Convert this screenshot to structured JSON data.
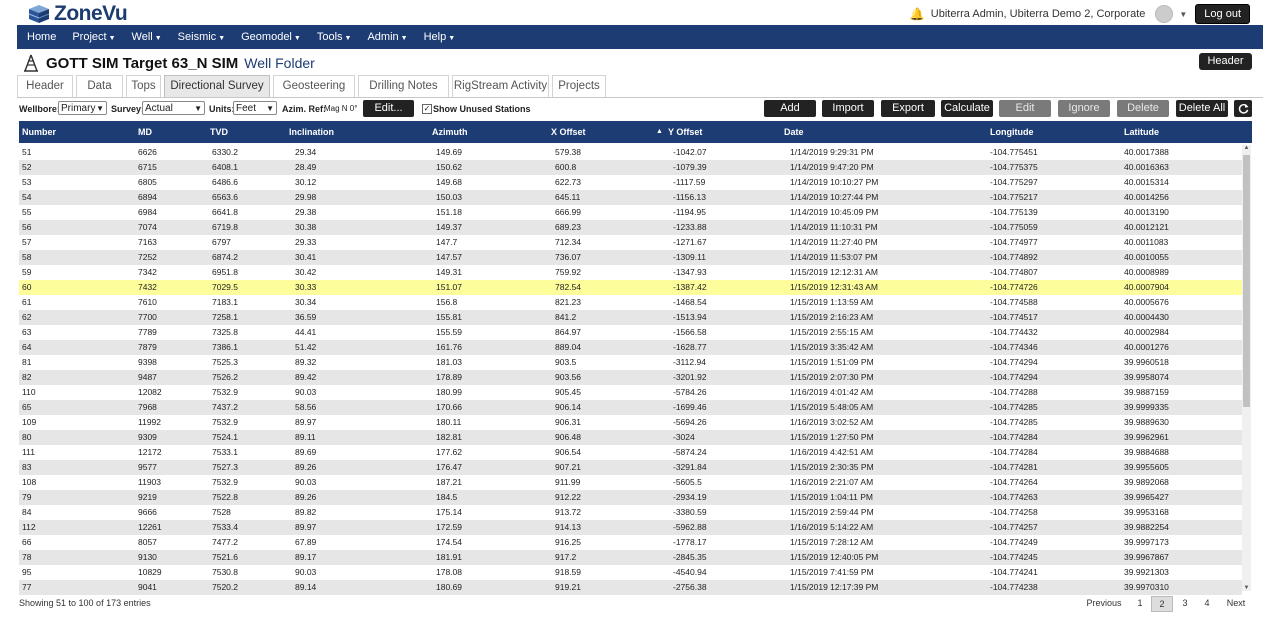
{
  "app": {
    "name": "ZoneVu"
  },
  "user": {
    "name": "Ubiterra Admin, Ubiterra Demo 2, Corporate",
    "logout_label": "Log out"
  },
  "nav": [
    {
      "label": "Home",
      "dropdown": false
    },
    {
      "label": "Project",
      "dropdown": true
    },
    {
      "label": "Well",
      "dropdown": true
    },
    {
      "label": "Seismic",
      "dropdown": true
    },
    {
      "label": "Geomodel",
      "dropdown": true
    },
    {
      "label": "Tools",
      "dropdown": true
    },
    {
      "label": "Admin",
      "dropdown": true
    },
    {
      "label": "Help",
      "dropdown": true
    }
  ],
  "well": {
    "title": "GOTT SIM Target 63_N SIM",
    "folder_label": "Well Folder",
    "header_button": "Header"
  },
  "tabs": [
    "Header",
    "Data",
    "Tops",
    "Directional Survey",
    "Geosteering",
    "Drilling Notes",
    "RigStream Activity",
    "Projects"
  ],
  "active_tab": "Directional Survey",
  "toolbar": {
    "wellbore_label": "Wellbore:",
    "wellbore_value": "Primary",
    "survey_label": "Survey:",
    "survey_value": "Actual",
    "units_label": "Units:",
    "units_value": "Feet",
    "azim_label": "Azim. Ref:",
    "azim_value": "Mag N 0°",
    "edit_ref_label": "Edit...",
    "show_unused_label": "Show Unused Stations",
    "show_unused_checked": true,
    "add": "Add",
    "import": "Import",
    "export": "Export",
    "calculate": "Calculate",
    "edit": "Edit",
    "ignore": "Ignore",
    "delete": "Delete",
    "delete_all": "Delete All"
  },
  "table": {
    "columns": [
      "Number",
      "MD",
      "TVD",
      "Inclination",
      "Azimuth",
      "X Offset",
      "Y Offset",
      "Date",
      "Longitude",
      "Latitude"
    ],
    "sorted_column": "X Offset",
    "sort_direction": "ascending",
    "highlighted_row": "60",
    "rows": [
      [
        "51",
        "6626",
        "6330.2",
        "29.34",
        "149.69",
        "579.38",
        "-1042.07",
        "1/14/2019 9:29:31 PM",
        "-104.775451",
        "40.0017388"
      ],
      [
        "52",
        "6715",
        "6408.1",
        "28.49",
        "150.62",
        "600.8",
        "-1079.39",
        "1/14/2019 9:47:20 PM",
        "-104.775375",
        "40.0016363"
      ],
      [
        "53",
        "6805",
        "6486.6",
        "30.12",
        "149.68",
        "622.73",
        "-1117.59",
        "1/14/2019 10:10:27 PM",
        "-104.775297",
        "40.0015314"
      ],
      [
        "54",
        "6894",
        "6563.6",
        "29.98",
        "150.03",
        "645.11",
        "-1156.13",
        "1/14/2019 10:27:44 PM",
        "-104.775217",
        "40.0014256"
      ],
      [
        "55",
        "6984",
        "6641.8",
        "29.38",
        "151.18",
        "666.99",
        "-1194.95",
        "1/14/2019 10:45:09 PM",
        "-104.775139",
        "40.0013190"
      ],
      [
        "56",
        "7074",
        "6719.8",
        "30.38",
        "149.37",
        "689.23",
        "-1233.88",
        "1/14/2019 11:10:31 PM",
        "-104.775059",
        "40.0012121"
      ],
      [
        "57",
        "7163",
        "6797",
        "29.33",
        "147.7",
        "712.34",
        "-1271.67",
        "1/14/2019 11:27:40 PM",
        "-104.774977",
        "40.0011083"
      ],
      [
        "58",
        "7252",
        "6874.2",
        "30.41",
        "147.57",
        "736.07",
        "-1309.11",
        "1/14/2019 11:53:07 PM",
        "-104.774892",
        "40.0010055"
      ],
      [
        "59",
        "7342",
        "6951.8",
        "30.42",
        "149.31",
        "759.92",
        "-1347.93",
        "1/15/2019 12:12:31 AM",
        "-104.774807",
        "40.0008989"
      ],
      [
        "60",
        "7432",
        "7029.5",
        "30.33",
        "151.07",
        "782.54",
        "-1387.42",
        "1/15/2019 12:31:43 AM",
        "-104.774726",
        "40.0007904"
      ],
      [
        "61",
        "7610",
        "7183.1",
        "30.34",
        "156.8",
        "821.23",
        "-1468.54",
        "1/15/2019 1:13:59 AM",
        "-104.774588",
        "40.0005676"
      ],
      [
        "62",
        "7700",
        "7258.1",
        "36.59",
        "155.81",
        "841.2",
        "-1513.94",
        "1/15/2019 2:16:23 AM",
        "-104.774517",
        "40.0004430"
      ],
      [
        "63",
        "7789",
        "7325.8",
        "44.41",
        "155.59",
        "864.97",
        "-1566.58",
        "1/15/2019 2:55:15 AM",
        "-104.774432",
        "40.0002984"
      ],
      [
        "64",
        "7879",
        "7386.1",
        "51.42",
        "161.76",
        "889.04",
        "-1628.77",
        "1/15/2019 3:35:42 AM",
        "-104.774346",
        "40.0001276"
      ],
      [
        "81",
        "9398",
        "7525.3",
        "89.32",
        "181.03",
        "903.5",
        "-3112.94",
        "1/15/2019 1:51:09 PM",
        "-104.774294",
        "39.9960518"
      ],
      [
        "82",
        "9487",
        "7526.2",
        "89.42",
        "178.89",
        "903.56",
        "-3201.92",
        "1/15/2019 2:07:30 PM",
        "-104.774294",
        "39.9958074"
      ],
      [
        "110",
        "12082",
        "7532.9",
        "90.03",
        "180.99",
        "905.45",
        "-5784.26",
        "1/16/2019 4:01:42 AM",
        "-104.774288",
        "39.9887159"
      ],
      [
        "65",
        "7968",
        "7437.2",
        "58.56",
        "170.66",
        "906.14",
        "-1699.46",
        "1/15/2019 5:48:05 AM",
        "-104.774285",
        "39.9999335"
      ],
      [
        "109",
        "11992",
        "7532.9",
        "89.97",
        "180.11",
        "906.31",
        "-5694.26",
        "1/16/2019 3:02:52 AM",
        "-104.774285",
        "39.9889630"
      ],
      [
        "80",
        "9309",
        "7524.1",
        "89.11",
        "182.81",
        "906.48",
        "-3024",
        "1/15/2019 1:27:50 PM",
        "-104.774284",
        "39.9962961"
      ],
      [
        "111",
        "12172",
        "7533.1",
        "89.69",
        "177.62",
        "906.54",
        "-5874.24",
        "1/16/2019 4:42:51 AM",
        "-104.774284",
        "39.9884688"
      ],
      [
        "83",
        "9577",
        "7527.3",
        "89.26",
        "176.47",
        "907.21",
        "-3291.84",
        "1/15/2019 2:30:35 PM",
        "-104.774281",
        "39.9955605"
      ],
      [
        "108",
        "11903",
        "7532.9",
        "90.03",
        "187.21",
        "911.99",
        "-5605.5",
        "1/16/2019 2:21:07 AM",
        "-104.774264",
        "39.9892068"
      ],
      [
        "79",
        "9219",
        "7522.8",
        "89.26",
        "184.5",
        "912.22",
        "-2934.19",
        "1/15/2019 1:04:11 PM",
        "-104.774263",
        "39.9965427"
      ],
      [
        "84",
        "9666",
        "7528",
        "89.82",
        "175.14",
        "913.72",
        "-3380.59",
        "1/15/2019 2:59:44 PM",
        "-104.774258",
        "39.9953168"
      ],
      [
        "112",
        "12261",
        "7533.4",
        "89.97",
        "172.59",
        "914.13",
        "-5962.88",
        "1/16/2019 5:14:22 AM",
        "-104.774257",
        "39.9882254"
      ],
      [
        "66",
        "8057",
        "7477.2",
        "67.89",
        "174.54",
        "916.25",
        "-1778.17",
        "1/15/2019 7:28:12 AM",
        "-104.774249",
        "39.9997173"
      ],
      [
        "78",
        "9130",
        "7521.6",
        "89.17",
        "181.91",
        "917.2",
        "-2845.35",
        "1/15/2019 12:40:05 PM",
        "-104.774245",
        "39.9967867"
      ],
      [
        "95",
        "10829",
        "7530.8",
        "90.03",
        "178.08",
        "918.59",
        "-4540.94",
        "1/15/2019 7:41:59 PM",
        "-104.774241",
        "39.9921303"
      ],
      [
        "77",
        "9041",
        "7520.2",
        "89.14",
        "180.69",
        "919.21",
        "-2756.38",
        "1/15/2019 12:17:39 PM",
        "-104.774238",
        "39.9970310"
      ]
    ]
  },
  "footer": {
    "info": "Showing 51 to 100 of 173 entries",
    "previous": "Previous",
    "next": "Next",
    "pages": [
      "1",
      "2",
      "3",
      "4"
    ],
    "current_page": "2"
  }
}
